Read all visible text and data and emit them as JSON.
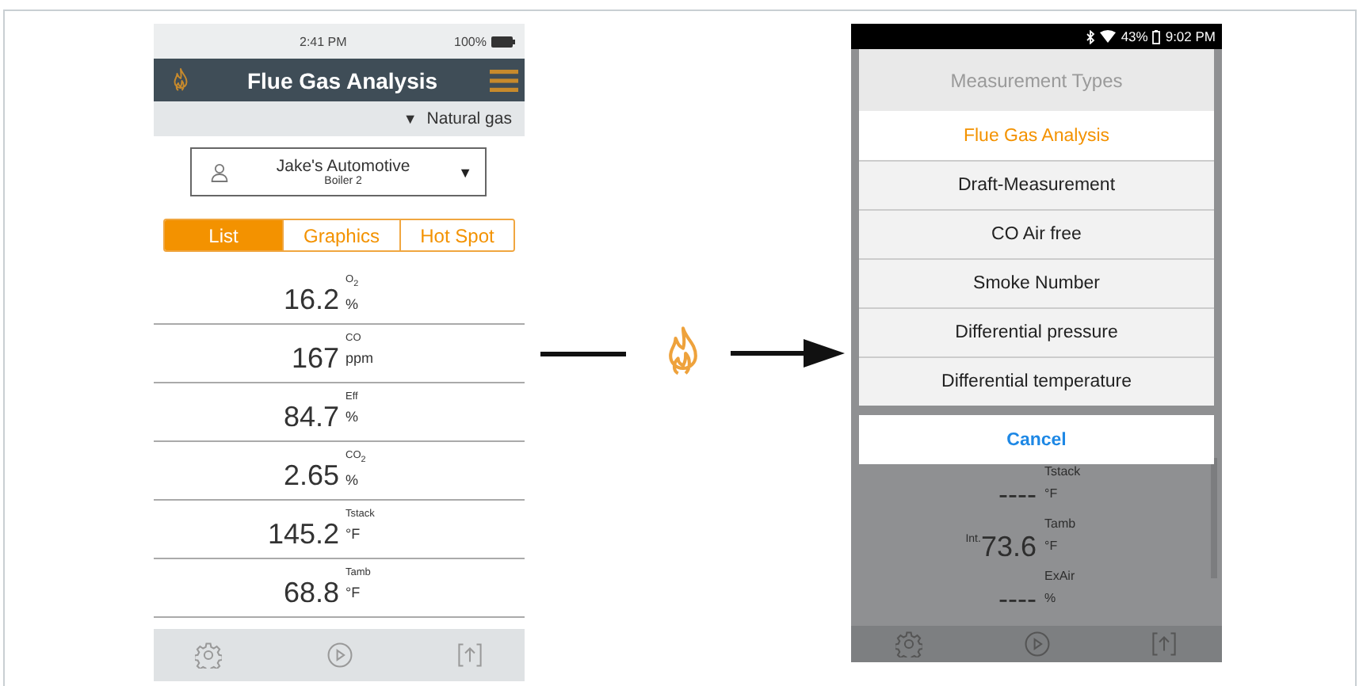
{
  "left_screen": {
    "status_bar": {
      "time": "2:41 PM",
      "battery": "100%"
    },
    "header": {
      "title": "Flue Gas Analysis"
    },
    "fuel": {
      "arrow": "▼",
      "label": "Natural gas"
    },
    "customer": {
      "name": "Jake's Automotive",
      "location": "Boiler 2",
      "arrow": "▼"
    },
    "tabs": [
      {
        "label": "List",
        "selected": true
      },
      {
        "label": "Graphics",
        "selected": false
      },
      {
        "label": "Hot Spot",
        "selected": false
      }
    ],
    "readings": [
      {
        "value": "16.2",
        "parameter": "O$_{2}$",
        "unit": "%"
      },
      {
        "value": "167",
        "parameter": "CO",
        "unit": "ppm"
      },
      {
        "value": "84.7",
        "parameter": "Eff",
        "unit": "%"
      },
      {
        "value": "2.65",
        "parameter": "CO$_{2}$",
        "unit": "%"
      },
      {
        "value": "145.2",
        "parameter": "Tstack",
        "unit": "°F"
      },
      {
        "value": "68.8",
        "parameter": "Tamb",
        "unit": "°F"
      }
    ]
  },
  "right_screen": {
    "status_bar": {
      "battery": "43%",
      "time": "9:02 PM"
    },
    "dialog": {
      "title": "Measurement Types",
      "options": [
        {
          "label": "Flue Gas Analysis",
          "selected": true
        },
        {
          "label": "Draft-Measurement",
          "selected": false
        },
        {
          "label": "CO Air free",
          "selected": false
        },
        {
          "label": "Smoke Number",
          "selected": false
        },
        {
          "label": "Differential pressure",
          "selected": false
        },
        {
          "label": "Differential temperature",
          "selected": false
        }
      ],
      "cancel": "Cancel"
    },
    "readings": [
      {
        "value": "----",
        "parameter": "Tstack",
        "unit": "°F"
      },
      {
        "prefix": "Int.",
        "value": "73.6",
        "parameter": "Tamb",
        "unit": "°F"
      },
      {
        "value": "----",
        "parameter": "ExAir",
        "unit": "%"
      }
    ]
  }
}
